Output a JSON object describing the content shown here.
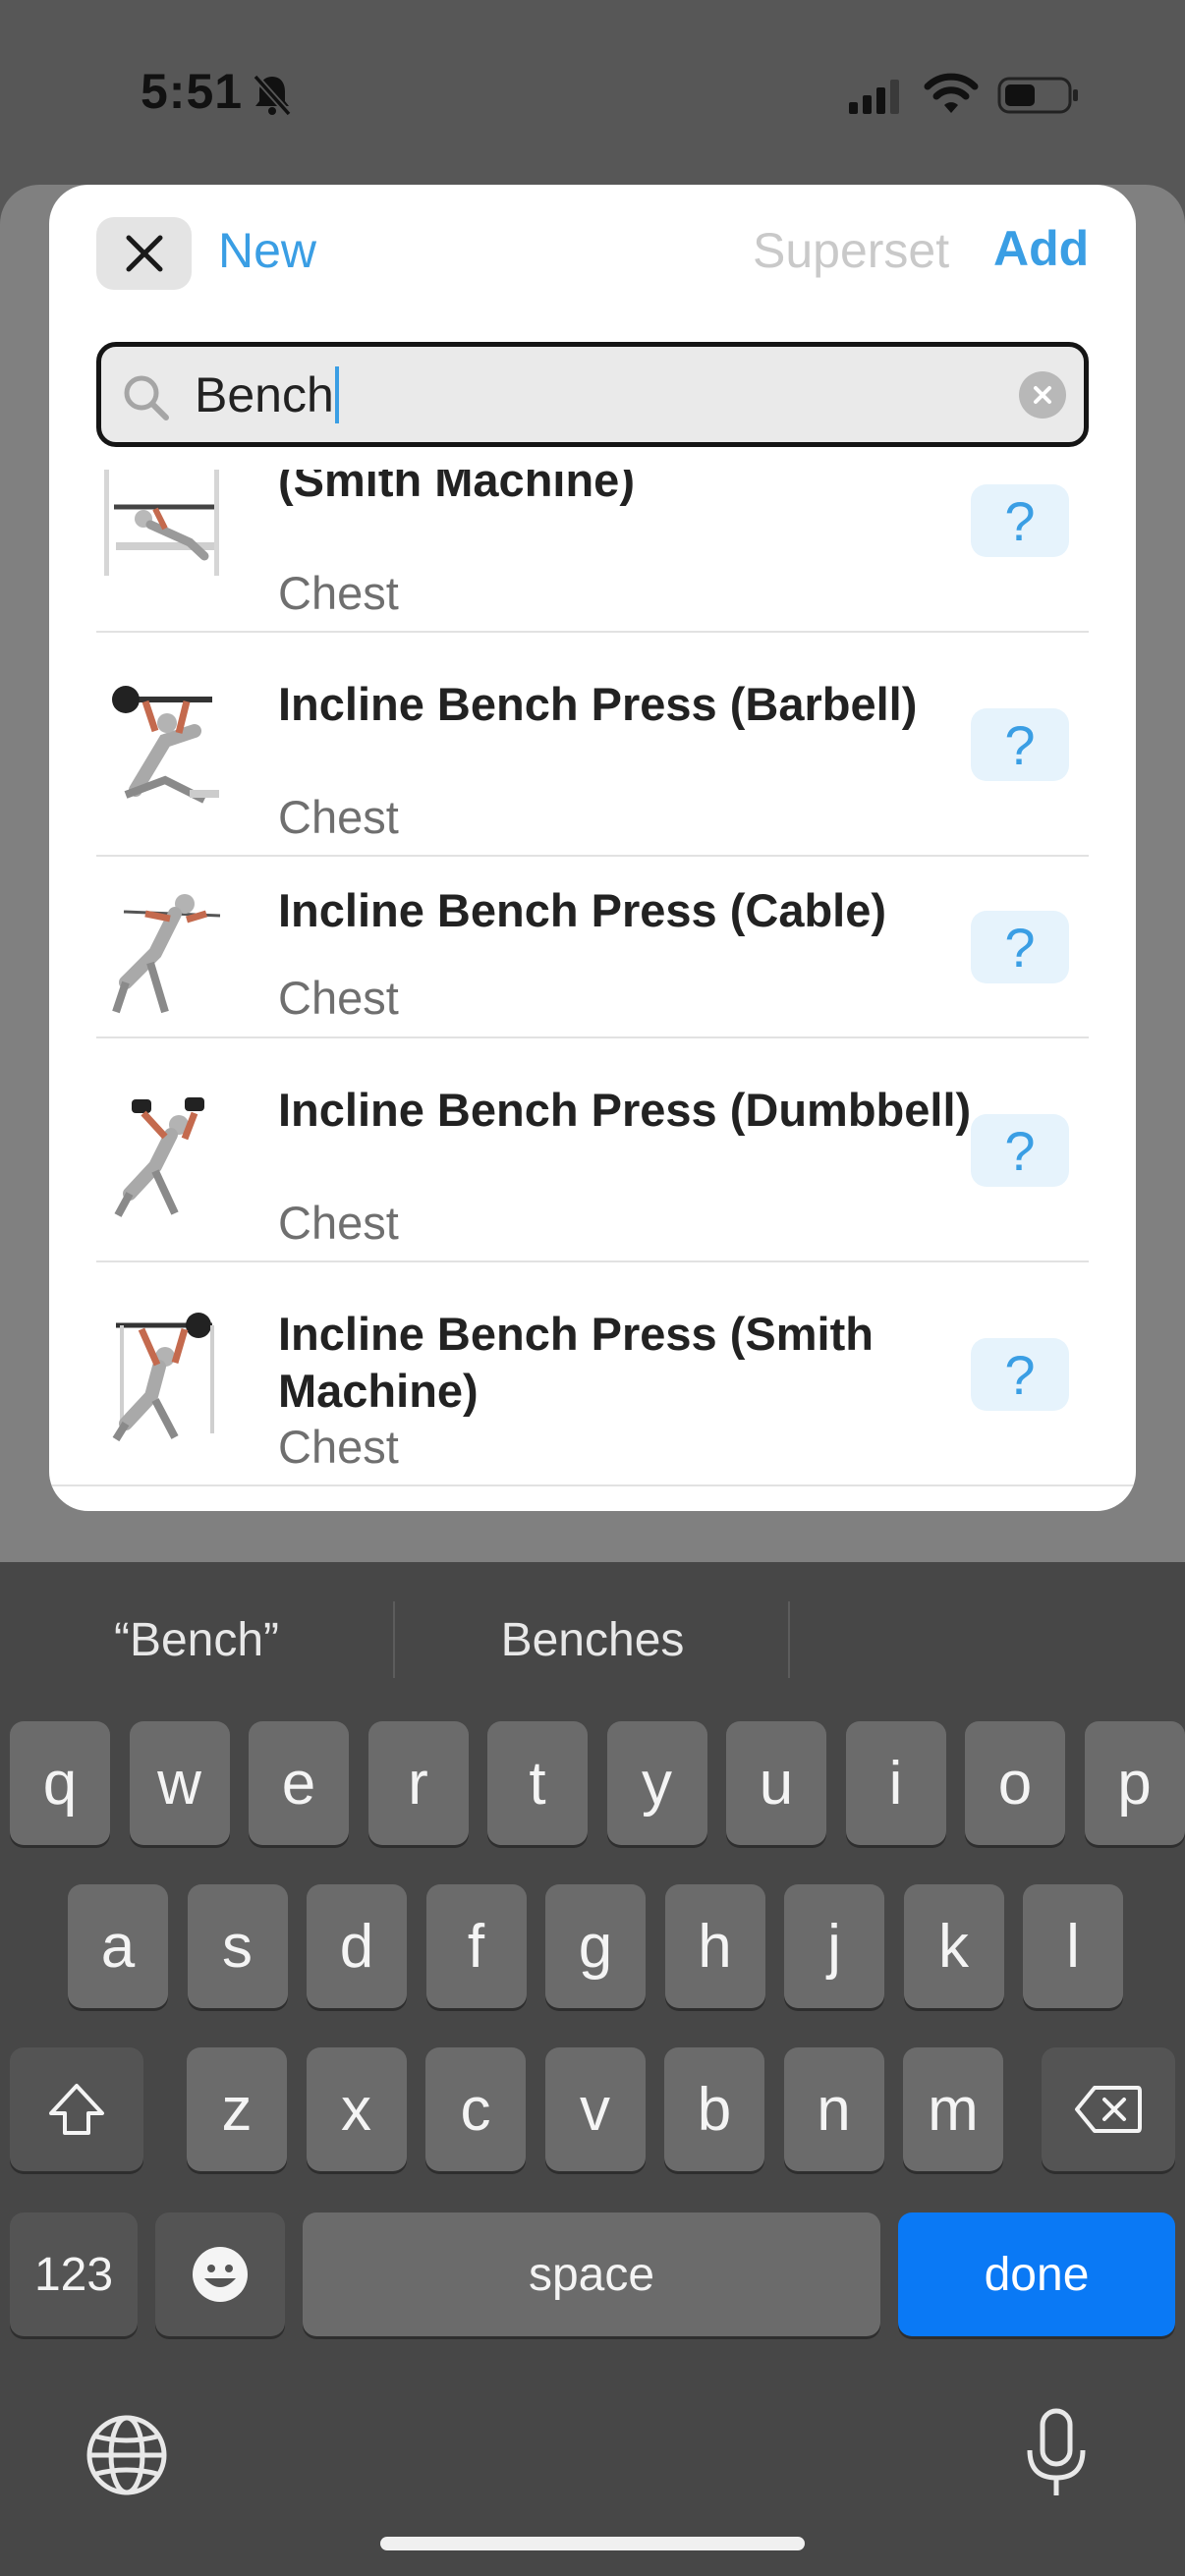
{
  "status_bar": {
    "time": "5:51"
  },
  "header": {
    "new_label": "New",
    "superset_label": "Superset",
    "add_label": "Add"
  },
  "search": {
    "value": "Bench"
  },
  "exercises": [
    {
      "title": "(Smith Machine)",
      "category": "Chest",
      "help": "?"
    },
    {
      "title": "Incline Bench Press (Barbell)",
      "category": "Chest",
      "help": "?"
    },
    {
      "title": "Incline Bench Press (Cable)",
      "category": "Chest",
      "help": "?"
    },
    {
      "title": "Incline Bench Press (Dumbbell)",
      "category": "Chest",
      "help": "?"
    },
    {
      "title": "Incline Bench Press (Smith Machine)",
      "category": "Chest",
      "help": "?"
    }
  ],
  "keyboard": {
    "suggestions": [
      "“Bench”",
      "Benches"
    ],
    "row1": [
      "q",
      "w",
      "e",
      "r",
      "t",
      "y",
      "u",
      "i",
      "o",
      "p"
    ],
    "row2": [
      "a",
      "s",
      "d",
      "f",
      "g",
      "h",
      "j",
      "k",
      "l"
    ],
    "row3": [
      "z",
      "x",
      "c",
      "v",
      "b",
      "n",
      "m"
    ],
    "numbers_label": "123",
    "space_label": "space",
    "done_label": "done"
  },
  "colors": {
    "accent": "#3a9ee4",
    "done_key": "#0a79f5"
  }
}
